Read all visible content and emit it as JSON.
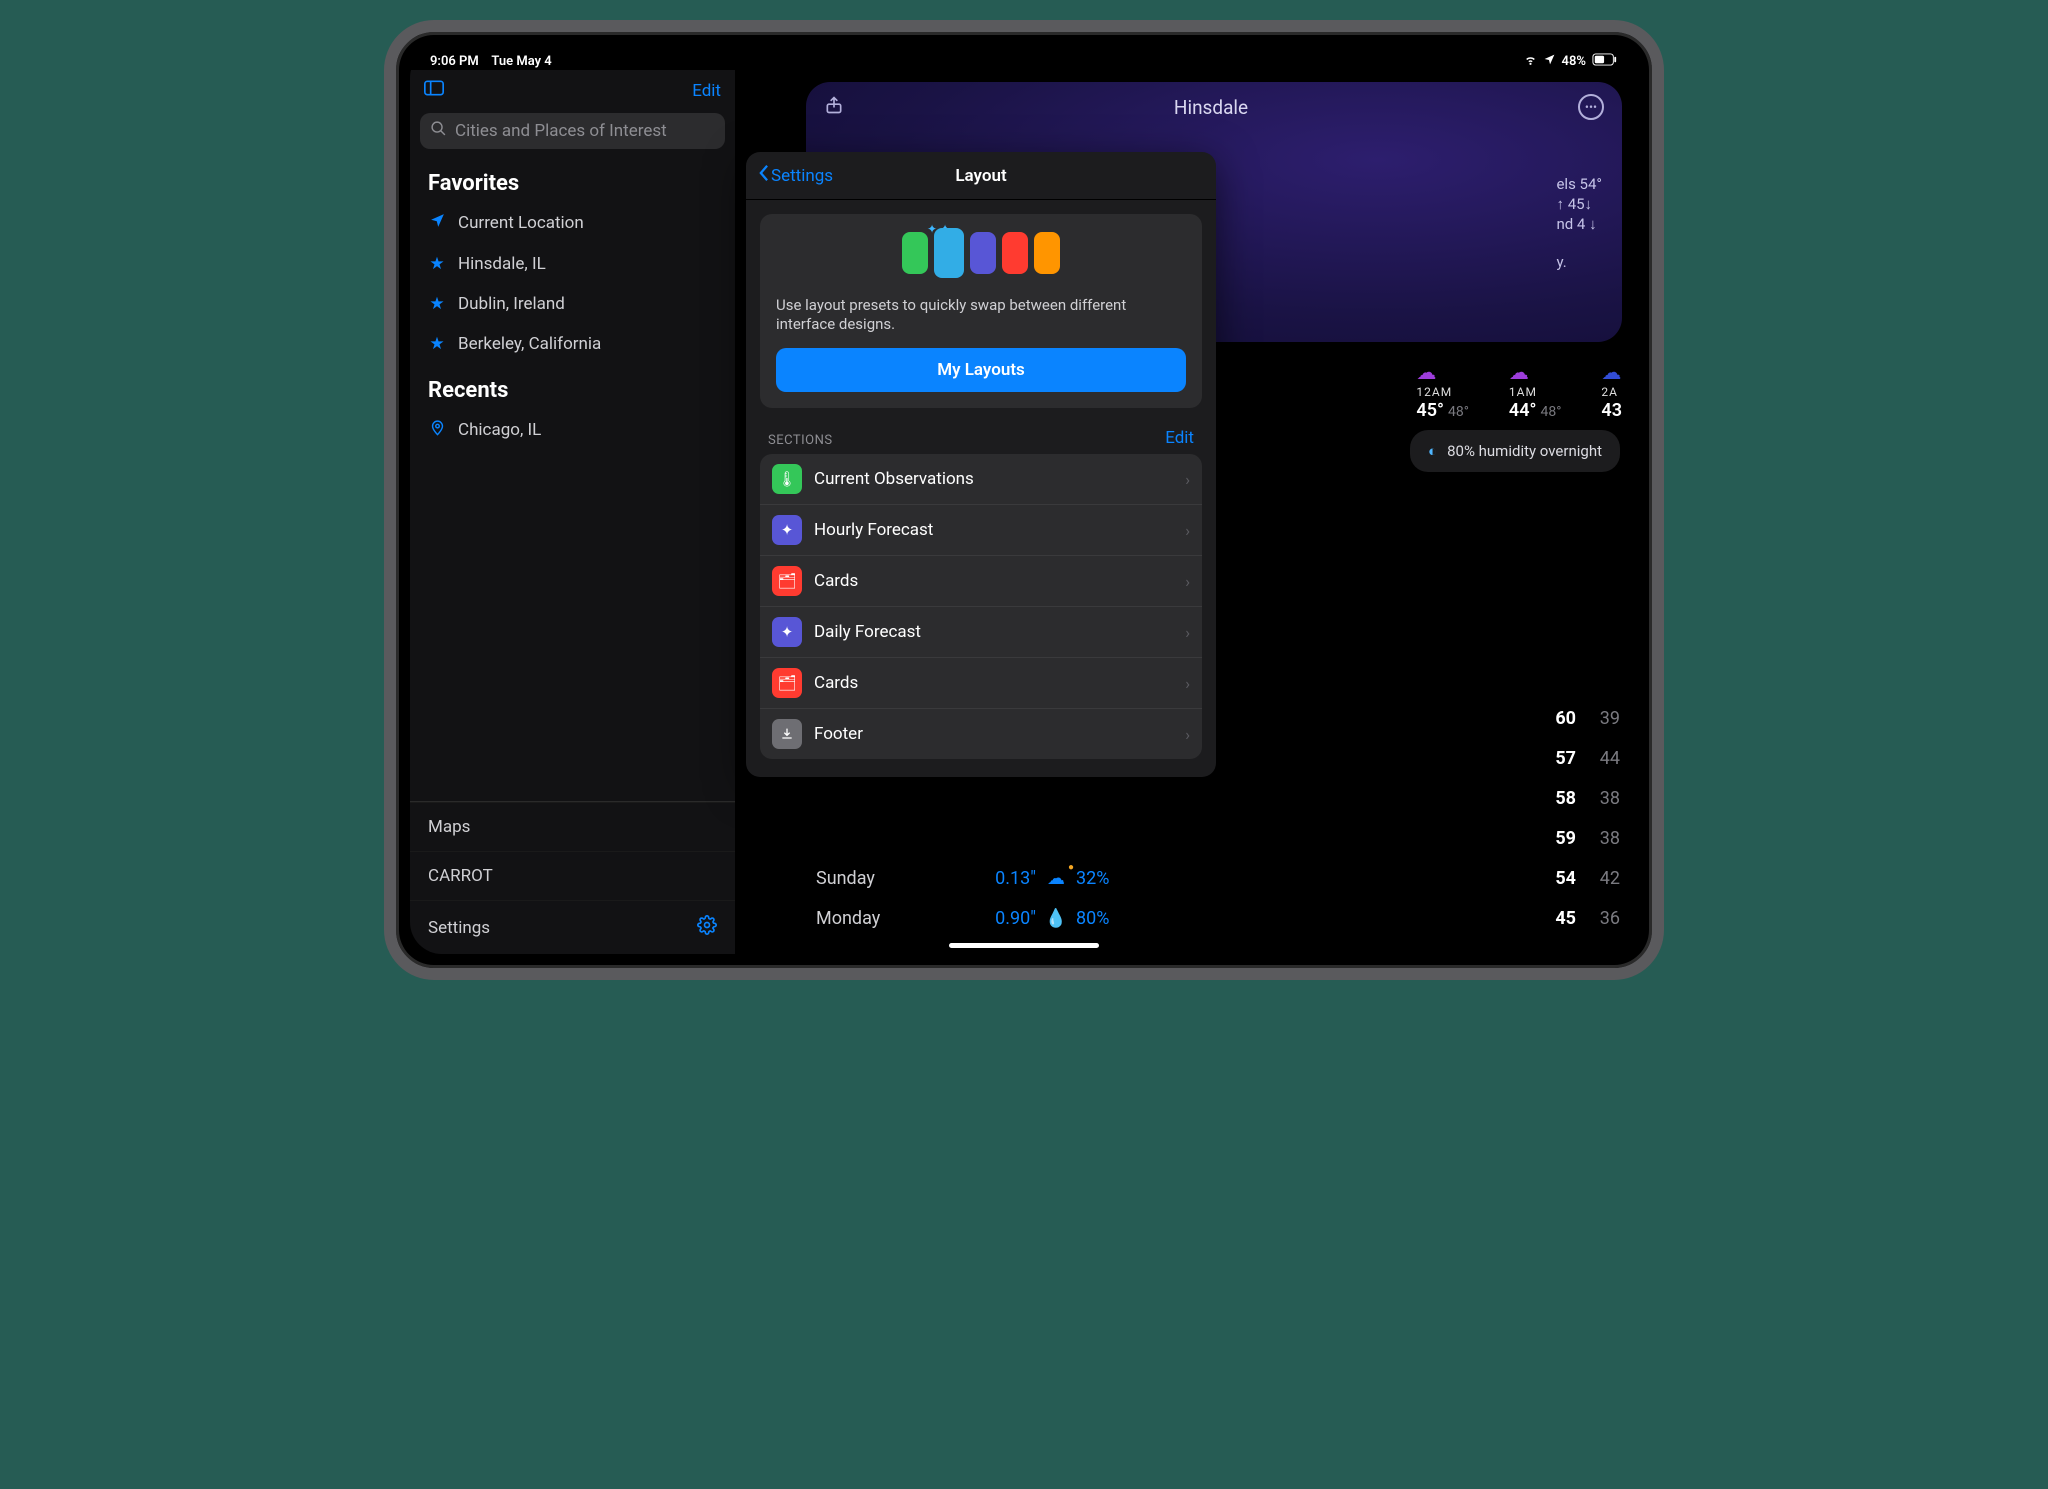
{
  "status": {
    "time": "9:06 PM",
    "date": "Tue May 4",
    "battery": "48%"
  },
  "sidebar": {
    "edit": "Edit",
    "search_placeholder": "Cities and Places of Interest",
    "favorites_head": "Favorites",
    "favorites": [
      {
        "icon": "location-arrow",
        "label": "Current Location"
      },
      {
        "icon": "star",
        "label": "Hinsdale, IL"
      },
      {
        "icon": "star",
        "label": "Dublin, Ireland"
      },
      {
        "icon": "star",
        "label": "Berkeley, California"
      }
    ],
    "recents_head": "Recents",
    "recents": [
      {
        "icon": "pin",
        "label": "Chicago, IL"
      }
    ],
    "bottom": {
      "maps": "Maps",
      "carrot": "CARROT",
      "settings": "Settings"
    }
  },
  "main": {
    "location": "Hinsdale",
    "observation_peek": [
      "els 54°",
      "↑ 45↓",
      "nd 4 ↓",
      "",
      "y."
    ],
    "hourly": [
      {
        "time": "12AM",
        "hi": "45°",
        "lo": "48°"
      },
      {
        "time": "1AM",
        "hi": "44°",
        "lo": "48°"
      },
      {
        "time": "2A",
        "hi": "43",
        "lo": ""
      }
    ],
    "humidity": "80% humidity overnight",
    "daily_hi_lo": [
      {
        "hi": "60",
        "lo": "39"
      },
      {
        "hi": "57",
        "lo": "44"
      },
      {
        "hi": "58",
        "lo": "38"
      },
      {
        "hi": "59",
        "lo": "38"
      },
      {
        "hi": "54",
        "lo": "42"
      },
      {
        "hi": "45",
        "lo": "36"
      }
    ],
    "daily_peek": [
      {
        "day": "Sunday",
        "precip": "0.13\"",
        "pct": "32%",
        "drop_color": "#f5a623"
      },
      {
        "day": "Monday",
        "precip": "0.90\"",
        "pct": "80%",
        "drop_color": "#0a84ff"
      }
    ]
  },
  "popover": {
    "back_label": "Settings",
    "title": "Layout",
    "preset_text": "Use layout presets to quickly swap between different interface designs.",
    "button": "My Layouts",
    "swatch_colors": [
      "#34c759",
      "#32ade6",
      "#5856d6",
      "#ff3b30",
      "#ff9500"
    ],
    "sections_label": "SECTIONS",
    "sections_edit": "Edit",
    "sections": [
      {
        "icon_bg": "#34c759",
        "glyph": "thermometer",
        "label": "Current Observations"
      },
      {
        "icon_bg": "#5856d6",
        "glyph": "sparkle",
        "label": "Hourly Forecast"
      },
      {
        "icon_bg": "#ff3b30",
        "glyph": "cards",
        "label": "Cards"
      },
      {
        "icon_bg": "#5856d6",
        "glyph": "sparkle",
        "label": "Daily Forecast"
      },
      {
        "icon_bg": "#ff3b30",
        "glyph": "cards",
        "label": "Cards"
      },
      {
        "icon_bg": "#6e6e73",
        "glyph": "download",
        "label": "Footer"
      }
    ]
  }
}
